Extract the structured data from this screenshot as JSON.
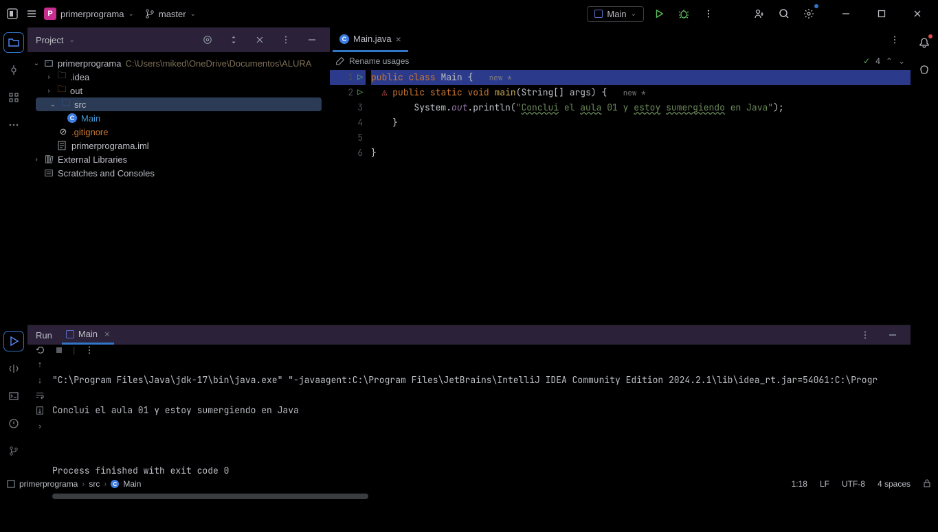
{
  "titlebar": {
    "project_initial": "P",
    "project_name": "primerprograma",
    "branch": "master"
  },
  "runconfig": {
    "label": "Main"
  },
  "project_tool": {
    "title": "Project",
    "root": "primerprograma",
    "root_path": "C:\\Users\\miked\\OneDrive\\Documentos\\ALURA",
    "idea_folder": ".idea",
    "out_folder": "out",
    "src_folder": "src",
    "main_class": "Main",
    "gitignore": ".gitignore",
    "iml_file": "primerprograma.iml",
    "ext_lib": "External Libraries",
    "scratches": "Scratches and Consoles"
  },
  "editor": {
    "tab_name": "Main.java",
    "rename_label": "Rename usages",
    "problems_count": "4",
    "lines": {
      "l1a": "public",
      "l1b": "class",
      "l1c": "Main",
      "l1d": "{",
      "l1hint": "new *",
      "l2a": "public",
      "l2b": "static",
      "l2c": "void",
      "l2d": "main",
      "l2e": "(String[] args) {",
      "l2hint": "new *",
      "l3a": "System.",
      "l3b": "out",
      "l3c": ".println(",
      "l3d": "\"",
      "l3e": "Conclui",
      "l3f": " el ",
      "l3g": "aula",
      "l3h": " 01 y ",
      "l3i": "estoy",
      "l3j": " ",
      "l3k": "sumergiendo",
      "l3l": " en Java\"",
      "l3m": ");",
      "l4": "    }",
      "l6": "}"
    }
  },
  "run_panel": {
    "title": "Run",
    "tab": "Main",
    "cmd": "\"C:\\Program Files\\Java\\jdk-17\\bin\\java.exe\" \"-javaagent:C:\\Program Files\\JetBrains\\IntelliJ IDEA Community Edition 2024.2.1\\lib\\idea_rt.jar=54061:C:\\Progr",
    "output": "Conclui el aula 01 y estoy sumergiendo en Java",
    "exit": "Process finished with exit code 0"
  },
  "statusbar": {
    "crumb1": "primerprograma",
    "crumb2": "src",
    "crumb3": "Main",
    "pos": "1:18",
    "eol": "LF",
    "enc": "UTF-8",
    "indent": "4 spaces"
  }
}
